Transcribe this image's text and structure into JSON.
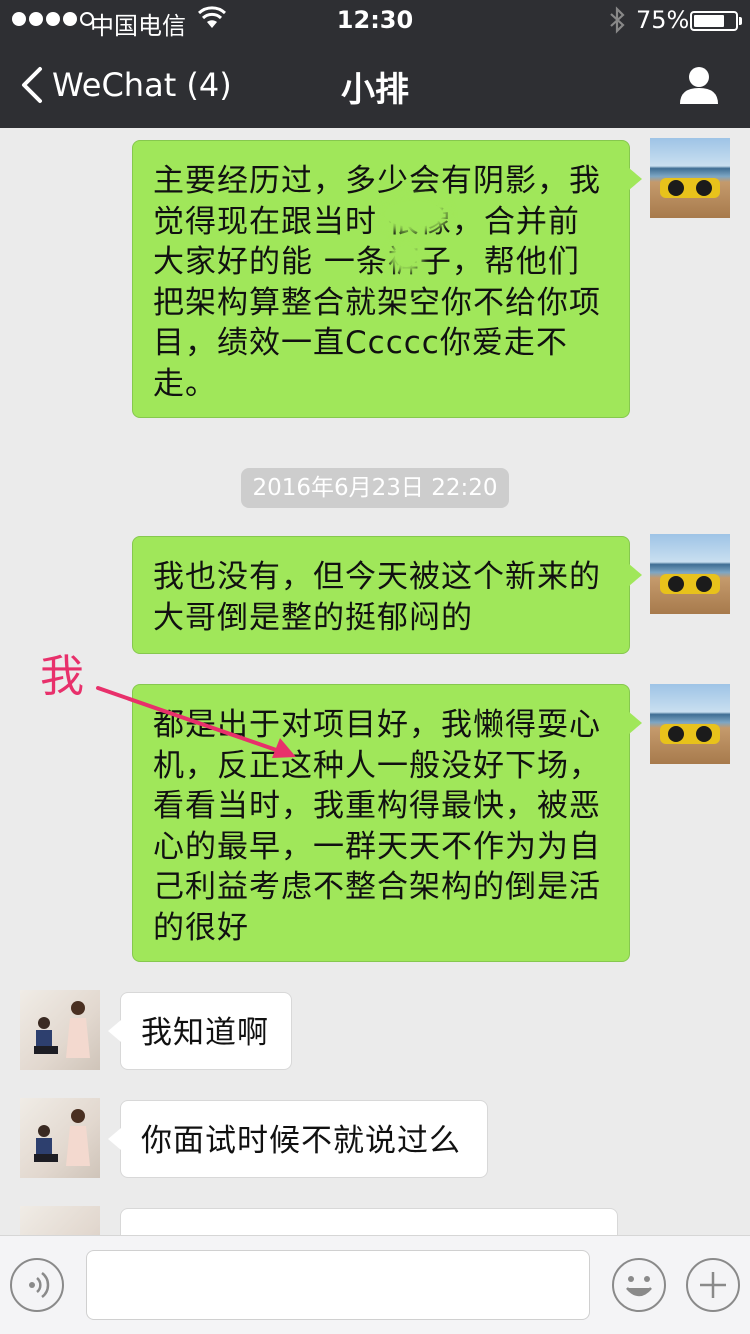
{
  "status_bar": {
    "carrier": "中国电信",
    "time": "12:30",
    "battery_percent_text": "75%",
    "battery_level": 0.75,
    "signal_bars": 4
  },
  "nav": {
    "back_label": "WeChat (4)",
    "title": "小排"
  },
  "messages": [
    {
      "sender": "me",
      "text": "主要经历过，多少会有阴影，我觉得现在跟当时    很像，合并前大家好的能    一条裤子，帮他们把架构算整合就架空你不给你项目，绩效一直Ccccc你爱走不走。"
    },
    {
      "sender": "me",
      "text": "我也没有，但今天被这个新来的大哥倒是整的挺郁闷的"
    },
    {
      "sender": "me",
      "text": "都是出于对项目好，我懒得耍心机，反正这种人一般没好下场，看看当时，我重构得最快，被恶心的最早，一群天天不作为为自己利益考虑不整合架构的倒是活的很好"
    },
    {
      "sender": "other",
      "text": "我知道啊"
    },
    {
      "sender": "other",
      "text": "你面试时候不就说过么"
    }
  ],
  "timestamp": "2016年6月23日 22:20",
  "annotation": {
    "label": "我",
    "color": "#e8306b"
  },
  "colors": {
    "nav_bg": "#2e2f33",
    "chat_bg": "#ebebeb",
    "outgoing_bubble": "#a0e75a",
    "incoming_bubble": "#ffffff"
  },
  "icons": {
    "back": "chevron-left-icon",
    "profile": "person-icon",
    "voice": "voice-icon",
    "emoji": "emoji-icon",
    "add": "plus-icon",
    "wifi": "wifi-icon",
    "bluetooth": "bluetooth-icon"
  }
}
